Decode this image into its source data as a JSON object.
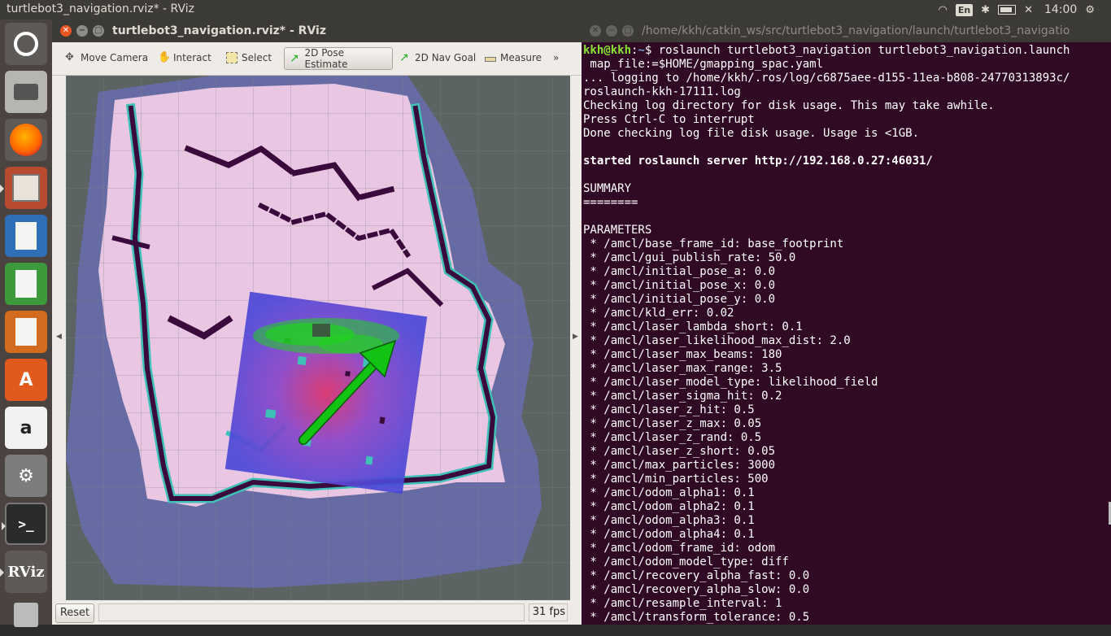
{
  "topbar": {
    "window_title": "turtlebot3_navigation.rviz* - RViz",
    "keyboard": "En",
    "clock": "14:00"
  },
  "launcher": {
    "items": [
      "ubuntu-dash",
      "camera-app",
      "firefox",
      "files",
      "writer",
      "calc",
      "impress",
      "software-center",
      "amazon",
      "system-settings",
      "terminal",
      "rviz",
      "trash"
    ],
    "rviz_label": "RViz"
  },
  "rviz": {
    "title": "turtlebot3_navigation.rviz* - RViz",
    "tools": [
      {
        "label": "Move Camera"
      },
      {
        "label": "Interact"
      },
      {
        "label": "Select"
      },
      {
        "label": "2D Pose Estimate"
      },
      {
        "label": "2D Nav Goal"
      },
      {
        "label": "Measure"
      }
    ],
    "reset_label": "Reset",
    "fps": "31 fps",
    "colors": {
      "map_bg": "#5b6363",
      "free_space": "#e8c4e0",
      "costmap_inflation": "#4b48d8",
      "obstacle": "#3a0a3c",
      "arrow": "#12c212"
    }
  },
  "terminal": {
    "title": "/home/kkh/catkin_ws/src/turtlebot3_navigation/launch/turtlebot3_navigatio",
    "prompt_user": "kkh@kkh",
    "prompt_dir": "~",
    "command": "$ roslaunch turtlebot3_navigation turtlebot3_navigation.launch map_file:=$HOME/gmapping_spac.yaml",
    "command_line1": "$ roslaunch turtlebot3_navigation turtlebot3_navigation.launch",
    "command_line2": " map_file:=$HOME/gmapping_spac.yaml",
    "lines": [
      "... logging to /home/kkh/.ros/log/c6875aee-d155-11ea-b808-24770313893c/",
      "roslaunch-kkh-17111.log",
      "Checking log directory for disk usage. This may take awhile.",
      "Press Ctrl-C to interrupt",
      "Done checking log file disk usage. Usage is <1GB."
    ],
    "server_line": "started roslaunch server http://192.168.0.27:46031/",
    "summary": "SUMMARY",
    "summary_rule": "========",
    "params_header": "PARAMETERS",
    "params": [
      " * /amcl/base_frame_id: base_footprint",
      " * /amcl/gui_publish_rate: 50.0",
      " * /amcl/initial_pose_a: 0.0",
      " * /amcl/initial_pose_x: 0.0",
      " * /amcl/initial_pose_y: 0.0",
      " * /amcl/kld_err: 0.02",
      " * /amcl/laser_lambda_short: 0.1",
      " * /amcl/laser_likelihood_max_dist: 2.0",
      " * /amcl/laser_max_beams: 180",
      " * /amcl/laser_max_range: 3.5",
      " * /amcl/laser_model_type: likelihood_field",
      " * /amcl/laser_sigma_hit: 0.2",
      " * /amcl/laser_z_hit: 0.5",
      " * /amcl/laser_z_max: 0.05",
      " * /amcl/laser_z_rand: 0.5",
      " * /amcl/laser_z_short: 0.05",
      " * /amcl/max_particles: 3000",
      " * /amcl/min_particles: 500",
      " * /amcl/odom_alpha1: 0.1",
      " * /amcl/odom_alpha2: 0.1",
      " * /amcl/odom_alpha3: 0.1",
      " * /amcl/odom_alpha4: 0.1",
      " * /amcl/odom_frame_id: odom",
      " * /amcl/odom_model_type: diff",
      " * /amcl/recovery_alpha_fast: 0.0",
      " * /amcl/recovery_alpha_slow: 0.0",
      " * /amcl/resample_interval: 1",
      " * /amcl/transform_tolerance: 0.5"
    ]
  }
}
